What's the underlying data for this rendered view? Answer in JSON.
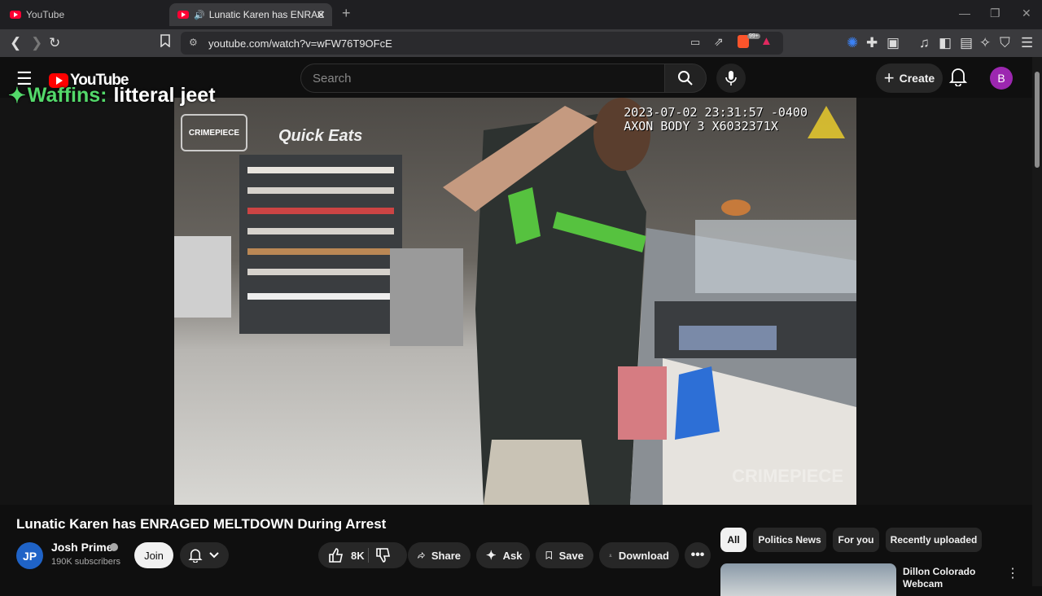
{
  "browser": {
    "tabs": [
      {
        "title": "YouTube"
      },
      {
        "title": "Lunatic Karen has ENRAGED M"
      }
    ],
    "url": "youtube.com/watch?v=wFW76T9OFcE",
    "extension_badge": "99+"
  },
  "youtube": {
    "logo_text": "YouTube",
    "search_placeholder": "Search",
    "create_label": "Create",
    "avatar_letter": "B",
    "overlay_user": "Waffins:",
    "overlay_message": "litteral jeet"
  },
  "video": {
    "timestamp_line1": "2023-07-02 23:31:57 -0400",
    "timestamp_line2": "AXON BODY 3 X6032371X",
    "brand_tag": "CRIMEPIECE",
    "sign_text": "Quick Eats",
    "watermark": "CRIMEPIECE",
    "title": "Lunatic Karen has ENRAGED MELTDOWN During Arrest"
  },
  "channel": {
    "avatar_text": "JP",
    "name": "Josh Prime",
    "subscribers": "190K subscribers",
    "join_label": "Join"
  },
  "actions": {
    "likes": "8K",
    "share": "Share",
    "ask": "Ask",
    "save": "Save",
    "download": "Download"
  },
  "chips": [
    "All",
    "Politics News",
    "For you",
    "Recently uploaded"
  ],
  "recommendation": {
    "title": "Dillon Colorado Webcam"
  }
}
